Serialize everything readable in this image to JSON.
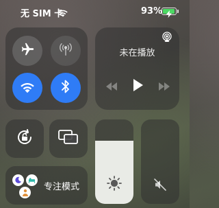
{
  "status_bar": {
    "carrier": "无 SIM 卡",
    "battery_percent": "93%",
    "battery_level": 0.93,
    "charging": true
  },
  "colors": {
    "accent_blue": "#2f7cf6",
    "battery_green": "#4cd964",
    "slider_fill": "#e9ebe6"
  },
  "connectivity": {
    "airplane": {
      "icon": "airplane-icon",
      "active": false
    },
    "cellular": {
      "icon": "cellular-antenna-icon",
      "active": false
    },
    "wifi": {
      "icon": "wifi-icon",
      "active": true
    },
    "bluetooth": {
      "icon": "bluetooth-icon",
      "active": true
    }
  },
  "media": {
    "title": "未在播放",
    "airplay_icon": "airplay-icon",
    "controls": [
      "rewind-icon",
      "play-icon",
      "fast-forward-icon"
    ]
  },
  "toggles": {
    "orientation_lock": {
      "icon": "rotation-lock-icon",
      "active": false
    },
    "screen_mirroring": {
      "icon": "screen-mirroring-icon"
    }
  },
  "sliders": {
    "brightness": {
      "icon": "sun-icon",
      "level": 0.75
    },
    "volume": {
      "icon": "speaker-muted-icon",
      "level": 0.0
    }
  },
  "focus": {
    "label": "专注模式",
    "icons": [
      "moon-icon",
      "bed-icon",
      "person-icon"
    ]
  }
}
